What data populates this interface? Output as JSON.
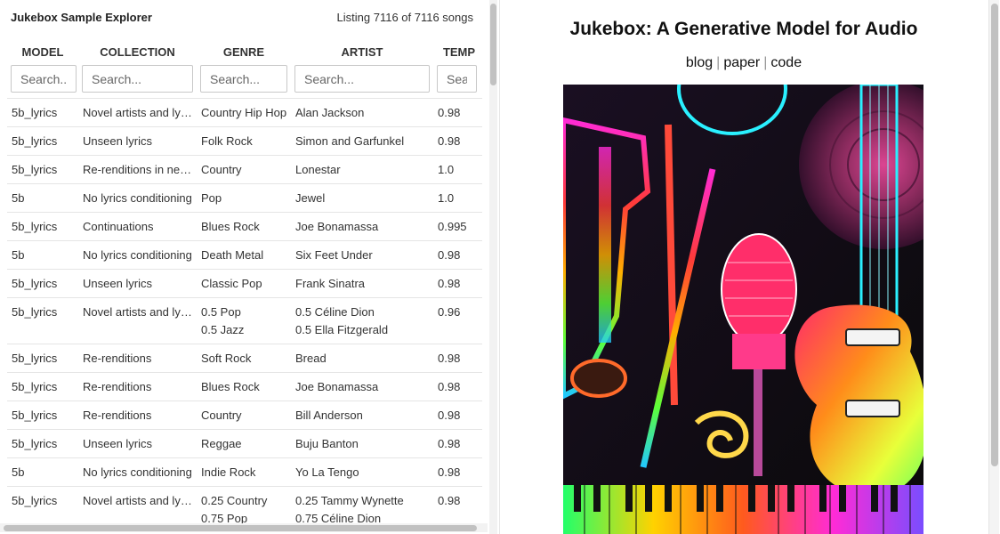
{
  "explorer": {
    "title": "Jukebox Sample Explorer",
    "listing": "Listing 7116 of 7116 songs",
    "columns": [
      {
        "header": "MODEL",
        "placeholder": "Search..."
      },
      {
        "header": "COLLECTION",
        "placeholder": "Search..."
      },
      {
        "header": "GENRE",
        "placeholder": "Search..."
      },
      {
        "header": "ARTIST",
        "placeholder": "Search..."
      },
      {
        "header": "TEMP",
        "placeholder": "Search..."
      }
    ],
    "rows": [
      {
        "model": "5b_lyrics",
        "collection": "Novel artists and lyrics",
        "genre": "Country Hip Hop",
        "artist": "Alan Jackson",
        "temp": "0.98"
      },
      {
        "model": "5b_lyrics",
        "collection": "Unseen lyrics",
        "genre": "Folk Rock",
        "artist": "Simon and Garfunkel",
        "temp": "0.98"
      },
      {
        "model": "5b_lyrics",
        "collection": "Re-renditions in new styles",
        "genre": "Country",
        "artist": "Lonestar",
        "temp": "1.0"
      },
      {
        "model": "5b",
        "collection": "No lyrics conditioning",
        "genre": "Pop",
        "artist": "Jewel",
        "temp": "1.0"
      },
      {
        "model": "5b_lyrics",
        "collection": "Continuations",
        "genre": "Blues Rock",
        "artist": "Joe Bonamassa",
        "temp": "0.995"
      },
      {
        "model": "5b",
        "collection": "No lyrics conditioning",
        "genre": "Death Metal",
        "artist": "Six Feet Under",
        "temp": "0.98"
      },
      {
        "model": "5b_lyrics",
        "collection": "Unseen lyrics",
        "genre": "Classic Pop",
        "artist": "Frank Sinatra",
        "temp": "0.98"
      },
      {
        "model": "5b_lyrics",
        "collection": "Novel artists and lyrics",
        "genre": "0.5 Pop",
        "genre2": "0.5 Jazz",
        "artist": "0.5 Céline Dion",
        "artist2": "0.5 Ella Fitzgerald",
        "temp": "0.96"
      },
      {
        "model": "5b_lyrics",
        "collection": "Re-renditions",
        "genre": "Soft Rock",
        "artist": "Bread",
        "temp": "0.98"
      },
      {
        "model": "5b_lyrics",
        "collection": "Re-renditions",
        "genre": "Blues Rock",
        "artist": "Joe Bonamassa",
        "temp": "0.98"
      },
      {
        "model": "5b_lyrics",
        "collection": "Re-renditions",
        "genre": "Country",
        "artist": "Bill Anderson",
        "temp": "0.98"
      },
      {
        "model": "5b_lyrics",
        "collection": "Unseen lyrics",
        "genre": "Reggae",
        "artist": "Buju Banton",
        "temp": "0.98"
      },
      {
        "model": "5b",
        "collection": "No lyrics conditioning",
        "genre": "Indie Rock",
        "artist": "Yo La Tengo",
        "temp": "0.98"
      },
      {
        "model": "5b_lyrics",
        "collection": "Novel artists and lyrics",
        "genre": "0.25 Country",
        "genre2": "0.75 Pop",
        "artist": "0.25 Tammy Wynette",
        "artist2": "0.75 Céline Dion",
        "temp": "0.98"
      }
    ]
  },
  "article": {
    "title": "Jukebox: A Generative Model for Audio",
    "links": [
      "blog",
      "paper",
      "code"
    ],
    "separator": "|",
    "hero_icon": "musical-instruments-collage-image"
  },
  "colors": {
    "text": "#222222",
    "border": "#e5e5e5",
    "scroll_thumb": "#c1c1c1"
  }
}
